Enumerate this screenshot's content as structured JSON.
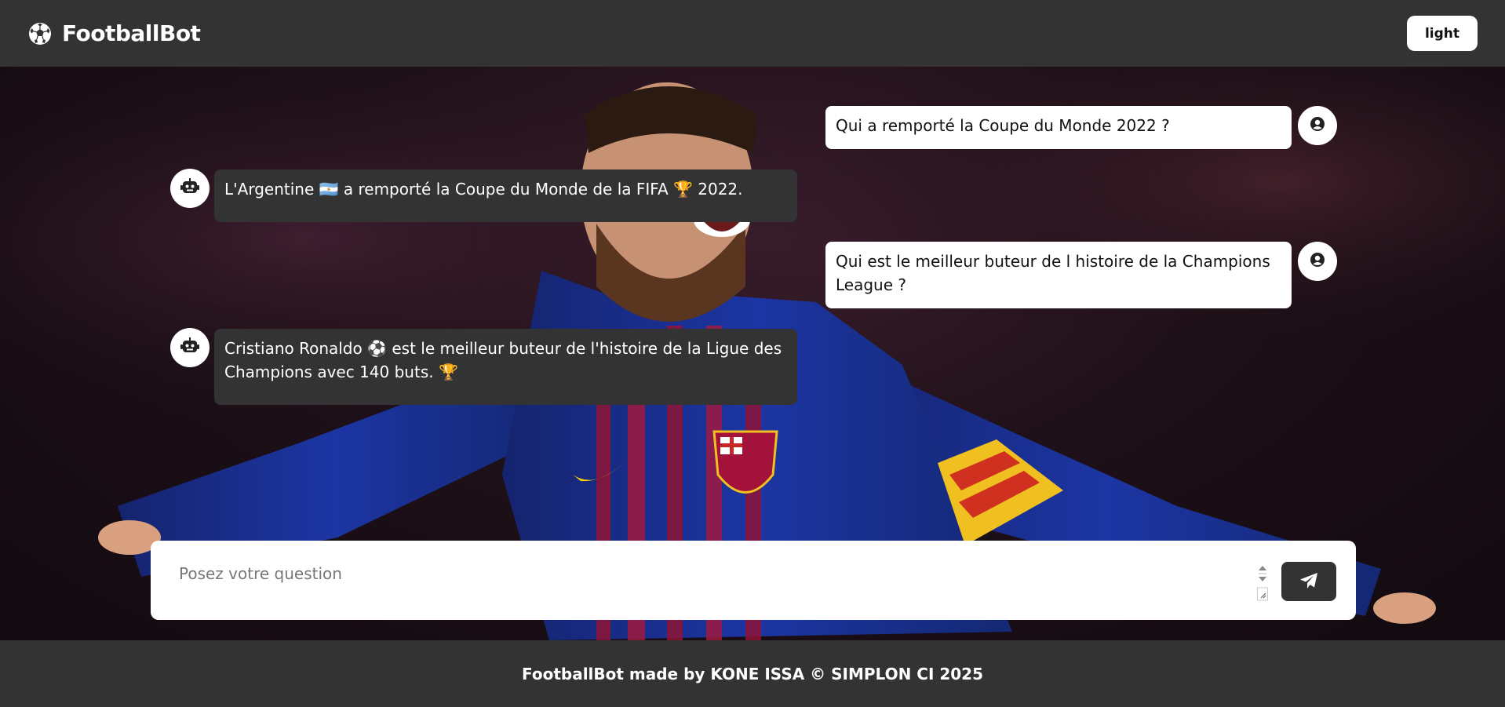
{
  "header": {
    "brand": "FootballBot",
    "brand_icon": "soccer-ball-icon",
    "theme_toggle_label": "light"
  },
  "chat": {
    "messages": [
      {
        "role": "user",
        "text": "Qui a remporté la Coupe du Monde 2022 ?",
        "avatar_icon": "user-circle-icon"
      },
      {
        "role": "bot",
        "text": "L'Argentine 🇦🇷 a remporté la Coupe du Monde de la FIFA 🏆 2022.",
        "avatar_icon": "robot-icon"
      },
      {
        "role": "user",
        "text": "Qui est le meilleur buteur de l histoire de la Champions League ?",
        "avatar_icon": "user-circle-icon"
      },
      {
        "role": "bot",
        "text": "Cristiano Ronaldo ⚽ est le meilleur buteur de l'histoire de la Ligue des Champions avec 140 buts. 🏆",
        "avatar_icon": "robot-icon"
      }
    ]
  },
  "input": {
    "placeholder": "Posez votre question",
    "value": "",
    "send_icon": "paper-plane-icon"
  },
  "footer": {
    "text": "FootballBot made by KONE ISSA © SIMPLON CI 2025"
  },
  "colors": {
    "chrome": "#333333",
    "user_bubble": "#ffffff",
    "bot_bubble": "#333333",
    "jersey_blue": "#1a2f8f",
    "jersey_red": "#a3123a"
  }
}
